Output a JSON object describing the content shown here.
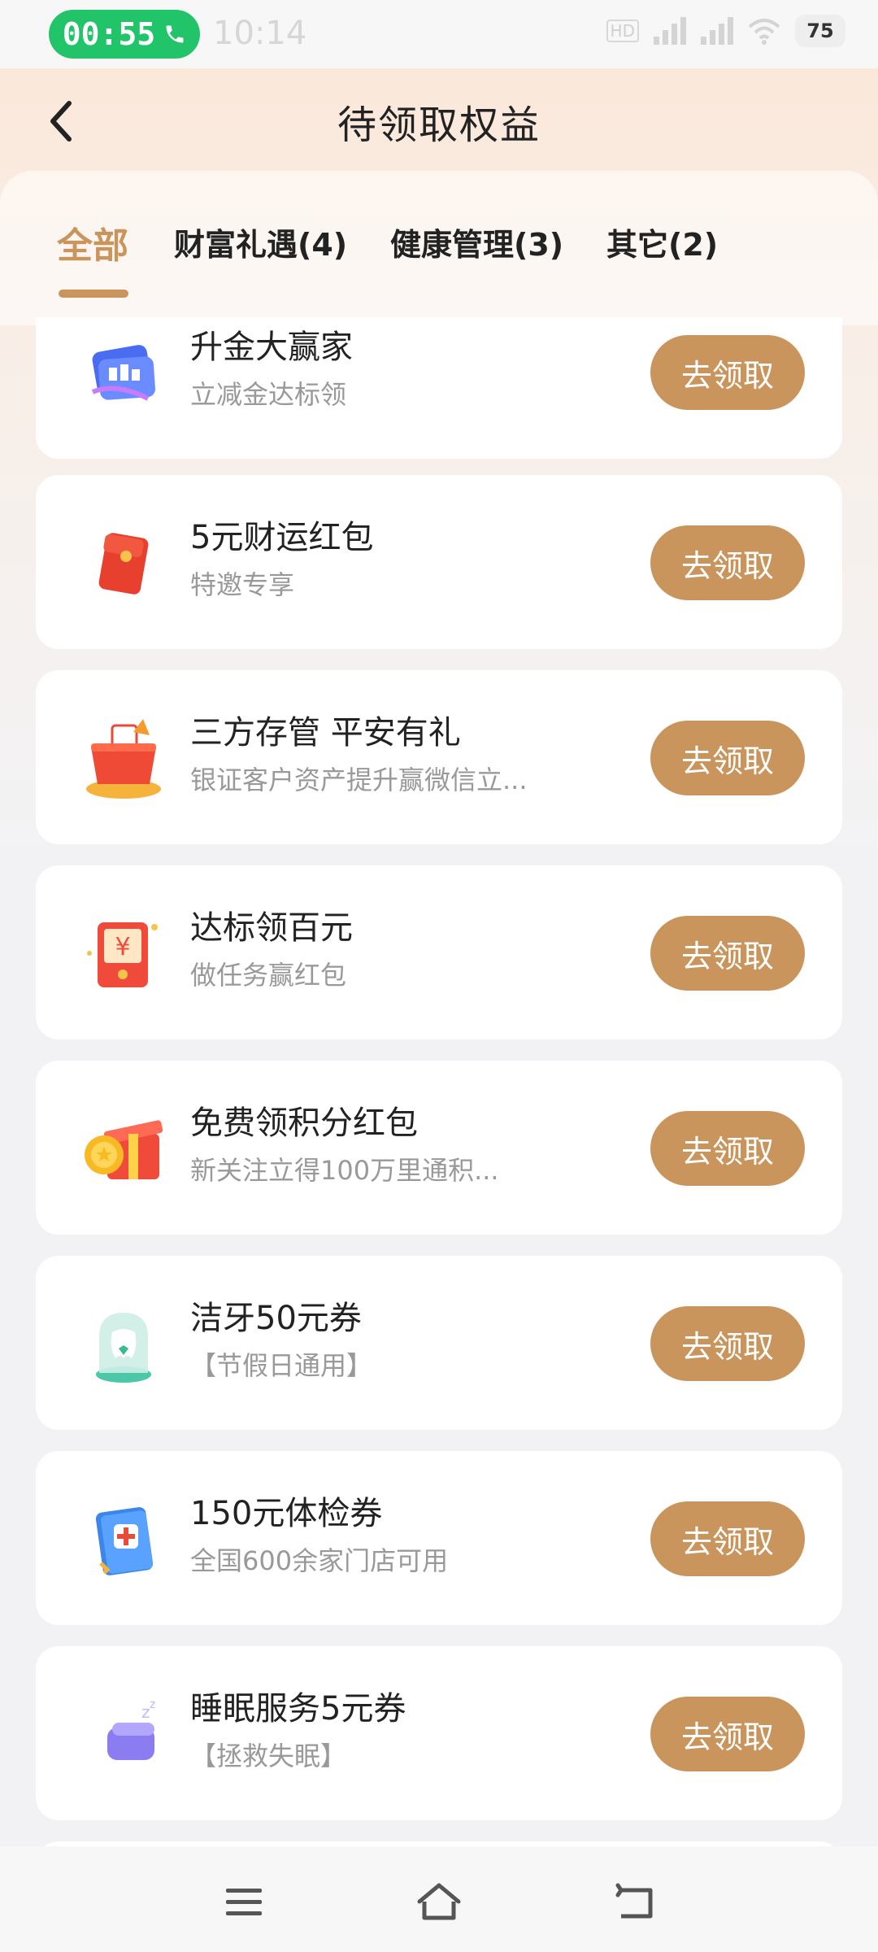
{
  "status_bar": {
    "call_timer": "00:55",
    "clock": "10:14",
    "hd_badge": "HD",
    "battery": "75"
  },
  "header": {
    "title": "待领取权益"
  },
  "tabs": [
    {
      "label": "全部",
      "active": true
    },
    {
      "label": "财富礼遇(4)",
      "active": false
    },
    {
      "label": "健康管理(3)",
      "active": false
    },
    {
      "label": "其它(2)",
      "active": false
    }
  ],
  "items": [
    {
      "title": "升金大赢家",
      "subtitle": "立减金达标领",
      "button": "去领取",
      "icon": "card-icon"
    },
    {
      "title": "5元财运红包",
      "subtitle": "特邀专享",
      "button": "去领取",
      "icon": "red-envelope-icon"
    },
    {
      "title": "三方存管 平安有礼",
      "subtitle": "银证客户资产提升赢微信立...",
      "button": "去领取",
      "icon": "gift-basket-icon"
    },
    {
      "title": "达标领百元",
      "subtitle": "做任务赢红包",
      "button": "去领取",
      "icon": "yuan-envelope-icon"
    },
    {
      "title": "免费领积分红包",
      "subtitle": "新关注立得100万里通积...",
      "button": "去领取",
      "icon": "gift-box-coin-icon"
    },
    {
      "title": "洁牙50元券",
      "subtitle": "【节假日通用】",
      "button": "去领取",
      "icon": "tooth-icon"
    },
    {
      "title": "150元体检券",
      "subtitle": "全国600余家门店可用",
      "button": "去领取",
      "icon": "medical-book-icon"
    },
    {
      "title": "睡眠服务5元券",
      "subtitle": "【拯救失眠】",
      "button": "去领取",
      "icon": "sleep-moon-icon"
    }
  ],
  "colors": {
    "accent": "#c9955c",
    "call_green": "#22c46a"
  }
}
